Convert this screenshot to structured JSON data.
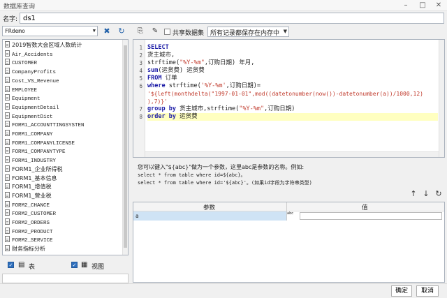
{
  "window": {
    "title": "数据库查询"
  },
  "name_field": {
    "label": "名字:",
    "value": "ds1"
  },
  "datasource": {
    "selected": "FRdemo"
  },
  "tables": [
    "2019智数大会区域人数统计",
    "Air_Accidents",
    "CUSTOMER",
    "CompanyProfits",
    "Cost_VS_Revenue",
    "EMPLOYEE",
    "Equipment",
    "EquipmentDetail",
    "EquipmentDict",
    "FORM1_ACCOUNTTINGSYSTEN",
    "FORM1_COMPANY",
    "FORM1_COMPANYLICENSE",
    "FORM1_COMPANYTYPE",
    "FORM1_INDUSTRY",
    "FORM1_企业所得税",
    "FORM1_基本信息",
    "FORM1_增值税",
    "FORM1_营业税",
    "FORM2_CHANCE",
    "FORM2_CUSTOMER",
    "FORM2_ORDERS",
    "FORM2_PRODUCT",
    "FORM2_SERVICE",
    "财务指标分析"
  ],
  "filters": {
    "table_label": "表",
    "view_label": "视图"
  },
  "toolbar": {
    "share_label": "共享数据集",
    "memory_option": "所有记录都保存在内存中"
  },
  "sql_lines": [
    "1",
    "2",
    "3",
    "4",
    "5",
    "6",
    "7",
    "8"
  ],
  "sql": {
    "l1": "SELECT",
    "l2": "货主城市,",
    "l3a": "strftime(",
    "l3b": "\"%Y-%m\"",
    "l3c": ",订购日期) 年月,",
    "l4a": "sum",
    "l4b": "(运货费) 运货费",
    "l5a": "FROM",
    "l5b": " 订单",
    "l6a": "where",
    "l6b": " strftime(",
    "l6c": "'%Y-%m'",
    "l6d": ",订购日期)=",
    "l6e": "'${left(monthdelta(\"1997-01-01\",mod((datetonumber(now())-datetonumber(a))/1000,12)",
    "l6f": "),7)}'",
    "l7a": "group by",
    "l7b": " 货主城市,strftime(",
    "l7c": "\"%Y-%m\"",
    "l7d": ",订购日期)",
    "l8a": "order by",
    "l8b": " 运货费"
  },
  "hint": {
    "line1": "您可以键入\"${abc}\"做为一个参数，这里abc是参数的名称。例如:",
    "line2": "select * from table where id=${abc}。",
    "line3": "select * from table where id='${abc}'。(如果id字段为字符串类型)"
  },
  "params": {
    "col_name": "参数",
    "col_value": "值",
    "rows": [
      {
        "name": "a",
        "type": "abc",
        "value": ""
      }
    ]
  },
  "footer": {
    "ok_label": "确定",
    "cancel_label": "取消"
  }
}
